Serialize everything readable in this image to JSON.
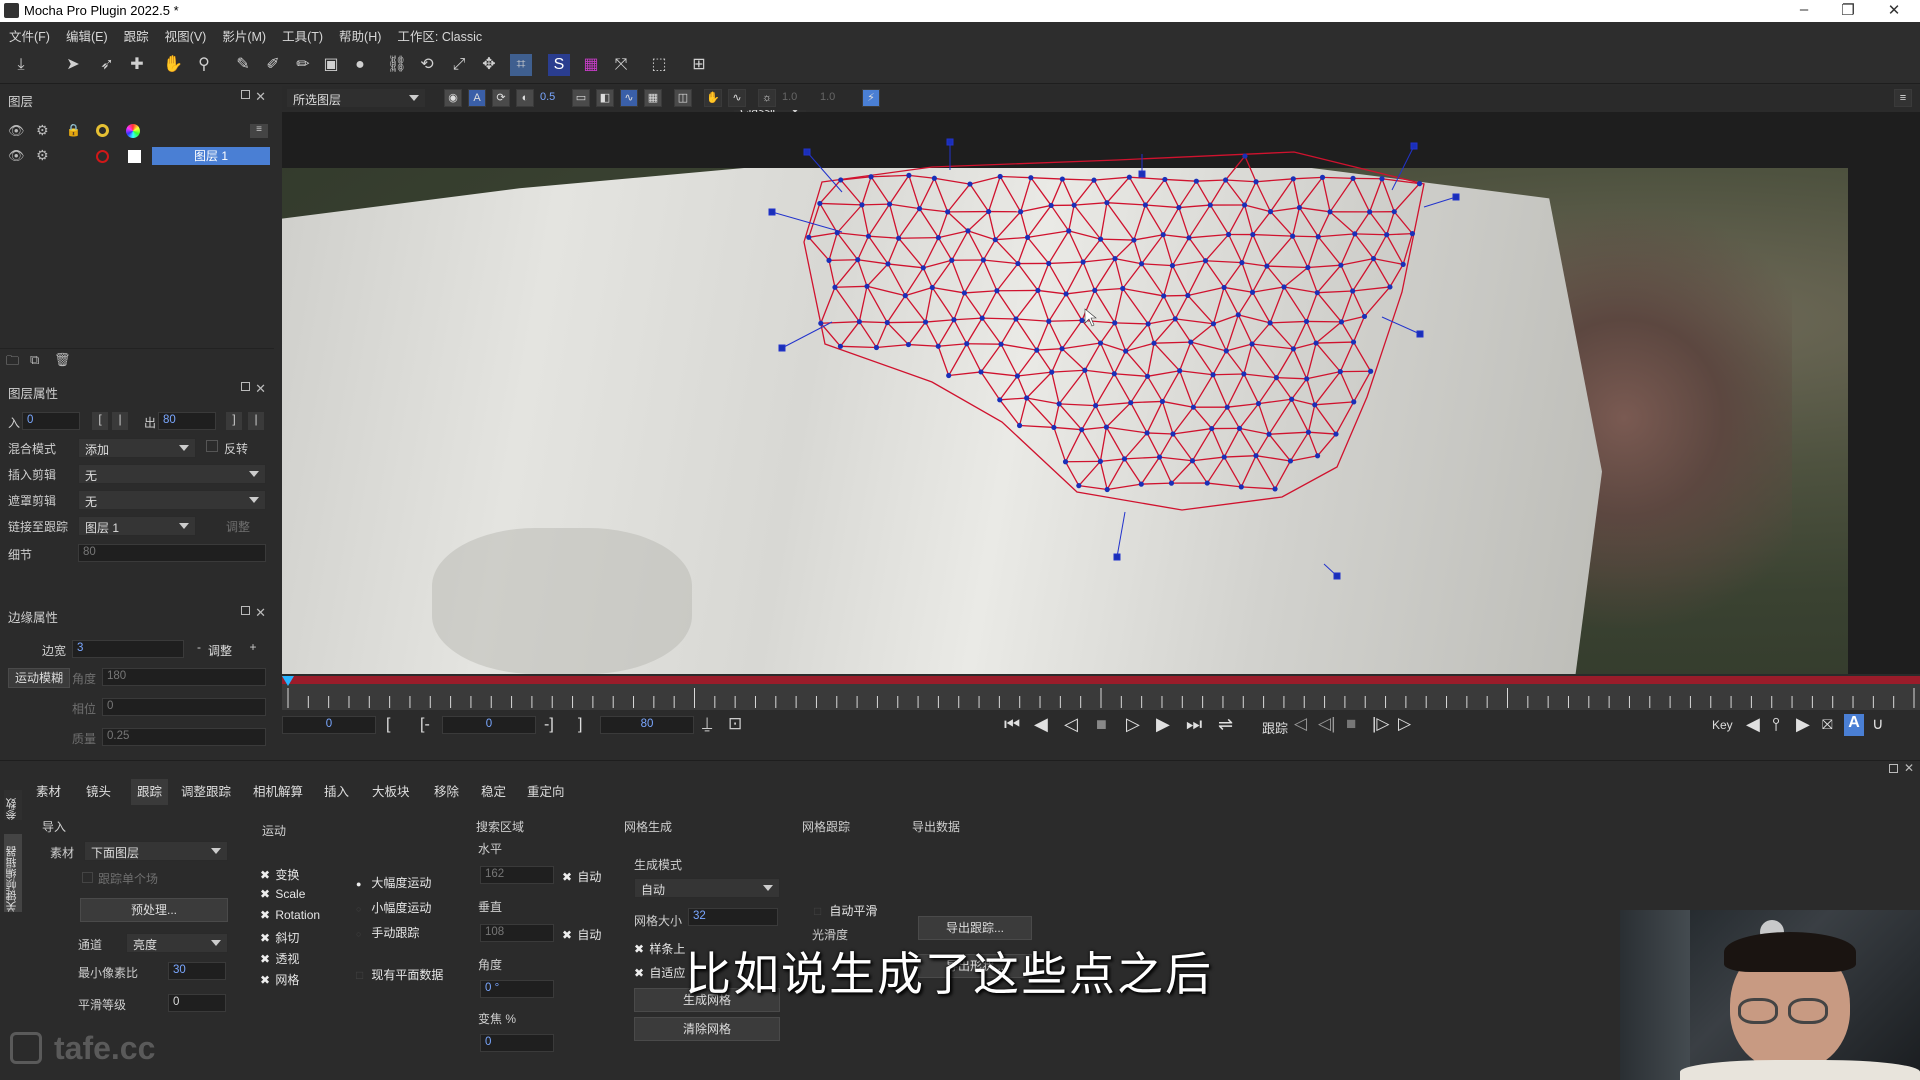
{
  "window": {
    "title": "Mocha Pro Plugin 2022.5 *"
  },
  "menu": [
    "文件(F)",
    "编辑(E)",
    "跟踪",
    "视图(V)",
    "影片(M)",
    "工具(T)",
    "帮助(H)",
    "工作区: Classic"
  ],
  "toolbar": {
    "workspace_select": "Classic"
  },
  "viewer": {
    "layer_filter": "所选图层",
    "opacity_a": "0.5",
    "zoom_a": "1.0",
    "zoom_b": "1.0"
  },
  "layers": {
    "title": "图层",
    "items": [
      {
        "name": "图层 1",
        "selected": true
      }
    ]
  },
  "layer_props": {
    "title": "图层属性",
    "in_label": "入",
    "in_value": "0",
    "out_label": "出",
    "out_value": "80",
    "blend_label": "混合模式",
    "blend_value": "添加",
    "invert_label": "反转",
    "insert_clip_label": "插入剪辑",
    "insert_clip_value": "无",
    "matte_clip_label": "遮罩剪辑",
    "matte_clip_value": "无",
    "link_track_label": "链接至跟踪",
    "link_track_value": "图层 1",
    "adjust_label": "调整",
    "detail_label": "细节",
    "detail_value": "80"
  },
  "edge_props": {
    "title": "边缘属性",
    "width_label": "边宽",
    "width_value": "3",
    "adjust_btn": "调整",
    "motion_blur_btn": "运动模糊",
    "angle_label": "角度",
    "angle_value": "180",
    "phase_label": "相位",
    "phase_value": "0",
    "quality_label": "质量",
    "quality_value": "0.25"
  },
  "timeline": {
    "in_value": "0",
    "current_value": "0",
    "out_value": "80",
    "track_label": "跟踪",
    "key_label": "Key"
  },
  "params": {
    "side_tabs": [
      "参数",
      "关键帧编辑器"
    ],
    "tabs": [
      "素材",
      "镜头",
      "跟踪",
      "调整跟踪",
      "相机解算",
      "插入",
      "大板块",
      "移除",
      "稳定",
      "重定向"
    ],
    "active_tab": "跟踪",
    "import": {
      "title": "导入",
      "clip_label": "素材",
      "clip_value": "下面图层",
      "track_single_label": "跟踪单个场",
      "preprocess_btn": "预处理...",
      "channel_label": "通道",
      "channel_value": "亮度",
      "min_pixel_label": "最小像素比",
      "min_pixel_value": "30",
      "smooth_label": "平滑等级",
      "smooth_value": "0"
    },
    "motion": {
      "title": "运动",
      "checks": [
        "变换",
        "Scale",
        "Rotation",
        "斜切",
        "透视",
        "网格"
      ],
      "radios": [
        "大幅度运动",
        "小幅度运动",
        "手动跟踪"
      ],
      "selected_radio": "大幅度运动",
      "existing_plane_label": "现有平面数据"
    },
    "search": {
      "title": "搜索区域",
      "horizontal_label": "水平",
      "horizontal_value": "162",
      "auto1": "自动",
      "vertical_label": "垂直",
      "vertical_value": "108",
      "auto2": "自动",
      "angle_label": "角度",
      "angle_value": "0 °",
      "zoom_label": "变焦 %",
      "zoom_value": "0"
    },
    "mesh_gen": {
      "title": "网格生成",
      "mode_label": "生成模式",
      "mode_value": "自动",
      "size_label": "网格大小",
      "size_value": "32",
      "snap_label": "样条上",
      "adaptive_label": "自适应",
      "generate_btn": "生成网格",
      "clear_btn": "清除网格"
    },
    "mesh_track": {
      "title": "网格跟踪",
      "auto_smooth_label": "自动平滑",
      "smoothness_label": "光滑度"
    },
    "export": {
      "title": "导出数据",
      "export_track_btn": "导出跟踪...",
      "export_shape_btn": "导出形状..."
    }
  },
  "subtitle": "比如说生成了这些点之后",
  "watermark": "tafe.cc",
  "colors": {
    "accent": "#4a7fd4",
    "timeline_bar": "#9a1c2a",
    "mesh_line": "#d0122e",
    "mesh_point": "#1a2fb8"
  }
}
